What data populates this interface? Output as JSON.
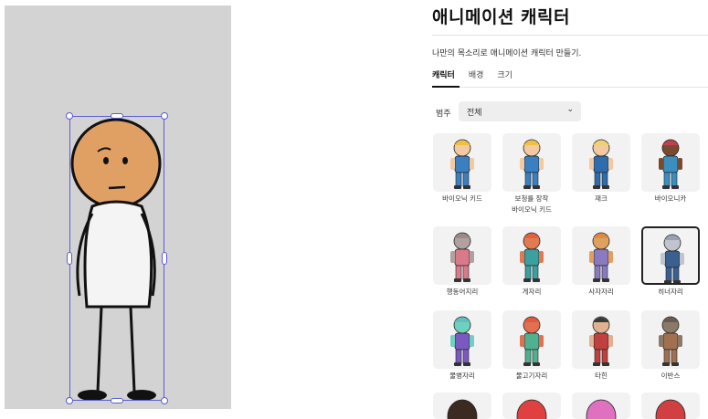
{
  "panel": {
    "title": "애니메이션 캐릭터",
    "subtitle": "나만의 목소리로 애니메이션 캐릭터 만들기.",
    "tabs": [
      {
        "label": "캐릭터",
        "active": true
      },
      {
        "label": "배경",
        "active": false
      },
      {
        "label": "크기",
        "active": false
      }
    ],
    "filter": {
      "label": "범주",
      "selected": "전체"
    }
  },
  "characters": [
    {
      "label": "바이오닉 키드",
      "icon": "hero-kid"
    },
    {
      "label": "보청를 장착\n바이오닉 키드",
      "icon": "hero-kid-hearing"
    },
    {
      "label": "재크",
      "icon": "hero-jack"
    },
    {
      "label": "바이오니카",
      "icon": "hero-girl"
    },
    {
      "label": "행동어지리",
      "icon": "raccoon"
    },
    {
      "label": "게자리",
      "icon": "fox"
    },
    {
      "label": "사자자리",
      "icon": "lion"
    },
    {
      "label": "히너자리",
      "icon": "wolf",
      "selected": true
    },
    {
      "label": "물병자리",
      "icon": "blue-creature"
    },
    {
      "label": "물고기자리",
      "icon": "red-fish"
    },
    {
      "label": "타힌",
      "icon": "guitar-boy"
    },
    {
      "label": "이반스",
      "icon": "robot"
    }
  ],
  "colors": {
    "selection": "#5b5bd6",
    "canvas": "#d3d3d3",
    "card": "#f2f2f2"
  }
}
